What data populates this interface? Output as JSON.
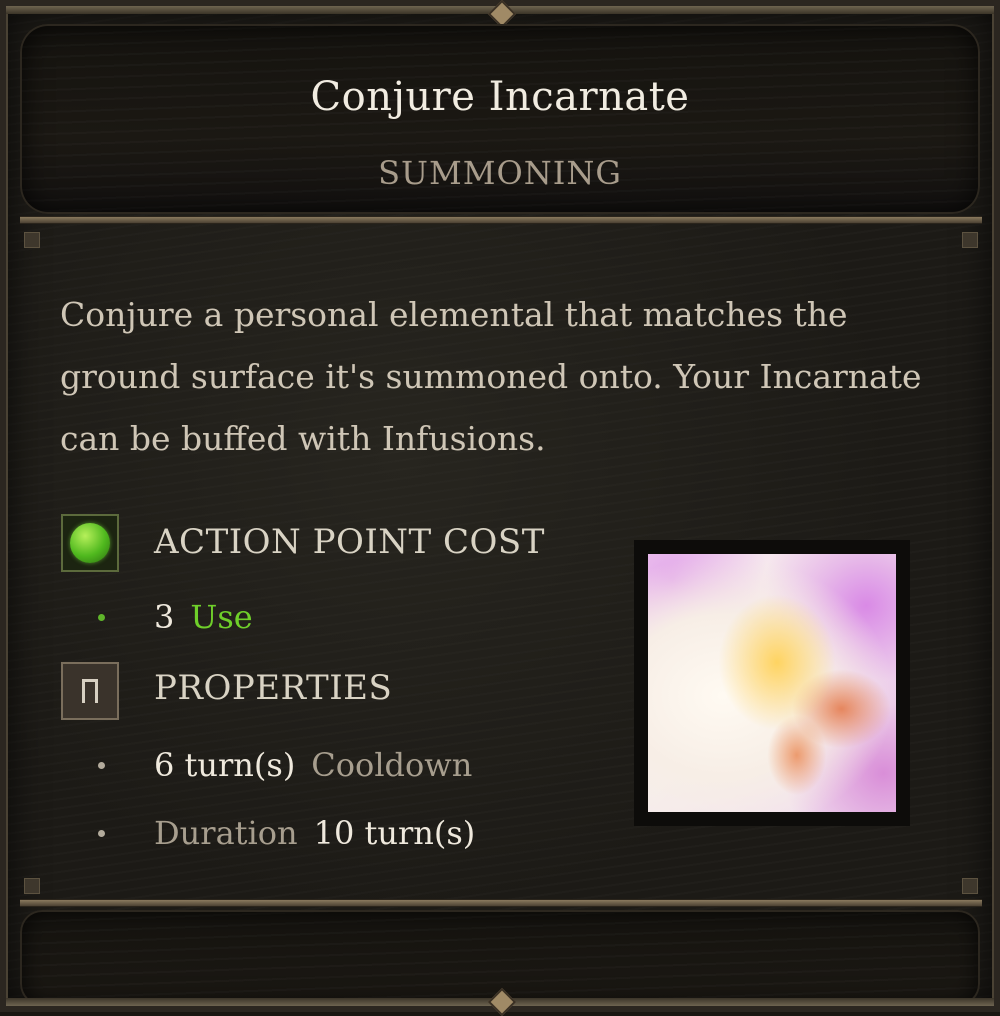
{
  "skill": {
    "title": "Conjure Incarnate",
    "school": "SUMMONING",
    "description": "Conjure a personal elemental that matches the ground surface it's summoned onto. Your Incarnate can be buffed with Infusions.",
    "icon": "conjure-incarnate-skill-icon"
  },
  "action_point_cost": {
    "heading": "ACTION POINT COST",
    "icon": "green-orb-icon",
    "value": "3",
    "label": "Use"
  },
  "properties": {
    "heading": "PROPERTIES",
    "icon": "bookmark-icon",
    "cooldown_value": "6 turn(s)",
    "cooldown_label": "Cooldown",
    "duration_label": "Duration",
    "duration_value": "10 turn(s)"
  },
  "colors": {
    "title": "#f1ece1",
    "school": "#a89c8b",
    "body_text": "#cfc6b6",
    "use_green": "#6fcf2a",
    "frame_gold": "#8a7a5e"
  }
}
